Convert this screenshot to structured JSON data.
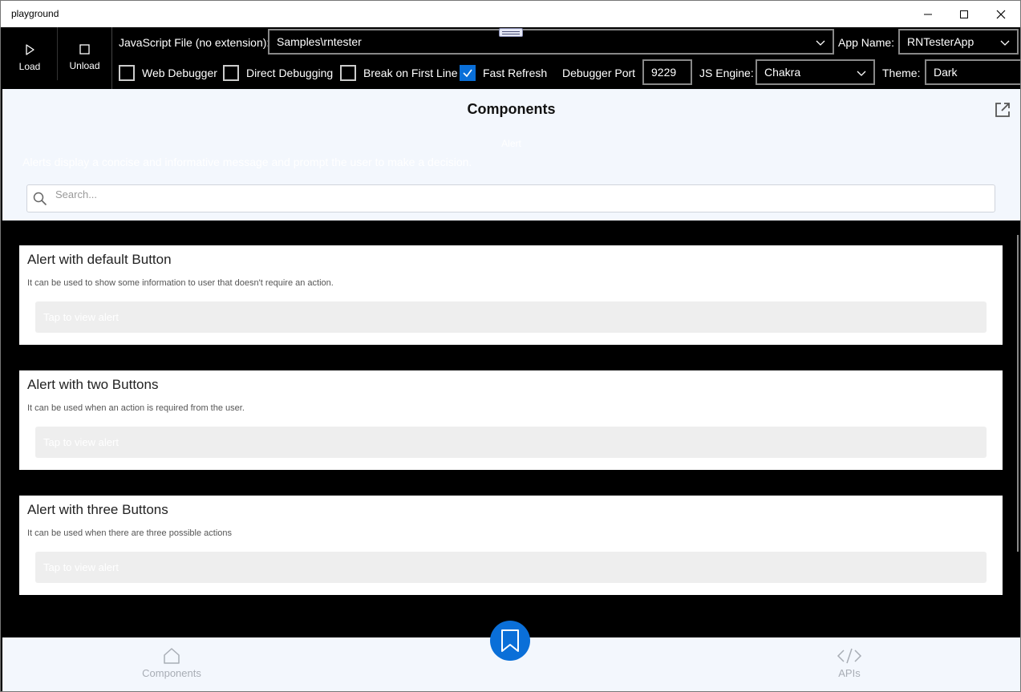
{
  "window": {
    "title": "playground"
  },
  "toolbar": {
    "load_label": "Load",
    "unload_label": "Unload",
    "js_file_label": "JavaScript File (no extension):",
    "js_file_value": "Samples\\rntester",
    "app_name_label": "App Name:",
    "app_name_value": "RNTesterApp",
    "web_debugger_label": "Web Debugger",
    "direct_debugging_label": "Direct Debugging",
    "break_first_line_label": "Break on First Line",
    "fast_refresh_label": "Fast Refresh",
    "debugger_port_label": "Debugger Port",
    "debugger_port_value": "9229",
    "js_engine_label": "JS Engine:",
    "js_engine_value": "Chakra",
    "theme_label": "Theme:",
    "theme_value": "Dark",
    "checkboxes": {
      "web_debugger": false,
      "direct_debugging": false,
      "break_first_line": false,
      "fast_refresh": true
    }
  },
  "header": {
    "title": "Components",
    "ghost_title": "Alert",
    "ghost_description": "Alerts display a concise and informative message and prompt the user to make a decision.",
    "search_placeholder": "Search..."
  },
  "examples": [
    {
      "title": "Alert with default Button",
      "description": "It can be used to show some information to user that doesn't require an action.",
      "button_label": "Tap to view alert"
    },
    {
      "title": "Alert with two Buttons",
      "description": "It can be used when an action is required from the user.",
      "button_label": "Tap to view alert"
    },
    {
      "title": "Alert with three Buttons",
      "description": "It can be used when there are three possible actions",
      "button_label": "Tap to view alert"
    }
  ],
  "bottom_nav": {
    "components_label": "Components",
    "apis_label": "APIs"
  },
  "colors": {
    "accent": "#0a6fd8",
    "header_bg": "#f3f7fd",
    "content_bg": "#000000"
  },
  "icons": [
    "play-icon",
    "stop-icon",
    "chevron-down-icon",
    "check-icon",
    "popout-icon",
    "search-icon",
    "home-icon",
    "code-icon",
    "bookmark-icon"
  ]
}
